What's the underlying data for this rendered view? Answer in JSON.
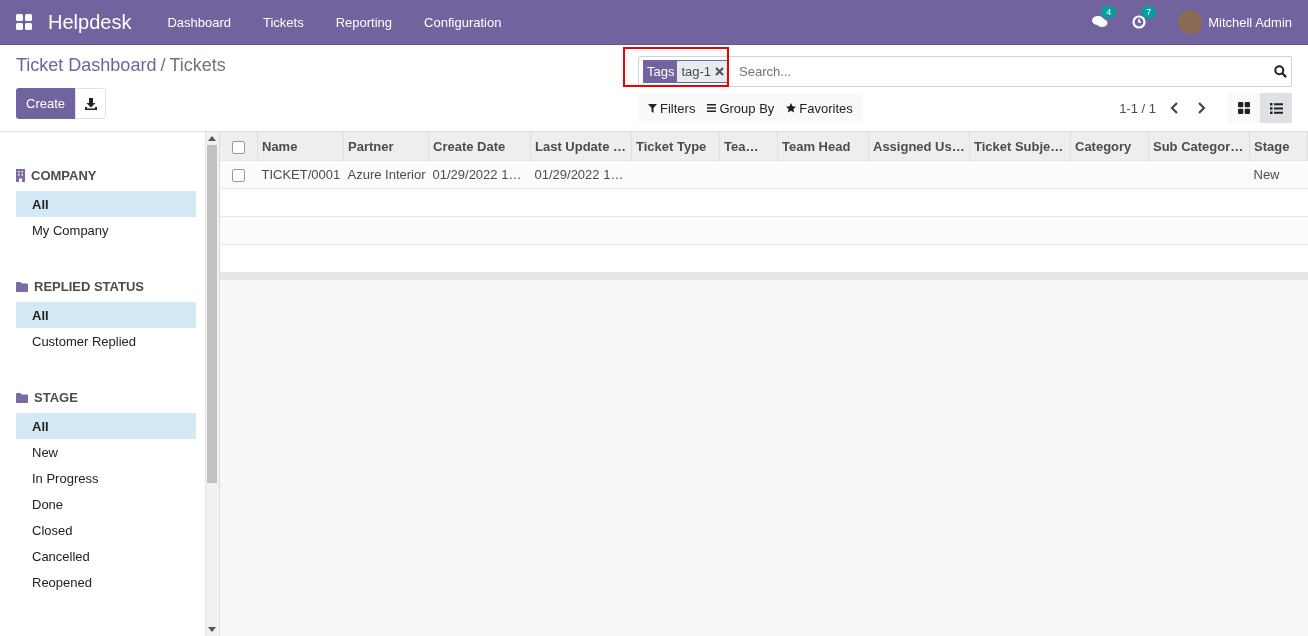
{
  "navbar": {
    "app_name": "Helpdesk",
    "menu": [
      "Dashboard",
      "Tickets",
      "Reporting",
      "Configuration"
    ],
    "messages_count": "4",
    "activities_count": "7",
    "user_name": "Mitchell Admin"
  },
  "breadcrumb": {
    "parent": "Ticket Dashboard",
    "separator": "/",
    "current": "Tickets"
  },
  "buttons": {
    "create": "Create"
  },
  "search": {
    "facets": [
      {
        "label": "Tags",
        "value": "tag-1"
      }
    ],
    "placeholder": "Search...",
    "highlighted": true
  },
  "search_options": [
    "Filters",
    "Group By",
    "Favorites"
  ],
  "pager": "1-1 / 1",
  "views": [
    {
      "kind": "kanban",
      "selected": false
    },
    {
      "kind": "list",
      "selected": true
    }
  ],
  "sidebar": {
    "sections": [
      {
        "kind": "company",
        "title": "COMPANY",
        "items": [
          {
            "label": "All",
            "selected": true
          },
          {
            "label": "My Company",
            "selected": false
          }
        ]
      },
      {
        "kind": "folder",
        "title": "REPLIED STATUS",
        "items": [
          {
            "label": "All",
            "selected": true
          },
          {
            "label": "Customer Replied",
            "selected": false
          }
        ]
      },
      {
        "kind": "folder",
        "title": "STAGE",
        "items": [
          {
            "label": "All",
            "selected": true
          },
          {
            "label": "New",
            "selected": false
          },
          {
            "label": "In Progress",
            "selected": false
          },
          {
            "label": "Done",
            "selected": false
          },
          {
            "label": "Closed",
            "selected": false
          },
          {
            "label": "Cancelled",
            "selected": false
          },
          {
            "label": "Reopened",
            "selected": false
          }
        ]
      }
    ]
  },
  "table": {
    "columns": [
      "Name",
      "Partner",
      "Create Date",
      "Last Update …",
      "Ticket Type",
      "Tea…",
      "Team Head",
      "Assigned Us…",
      "Ticket Subje…",
      "Category",
      "Sub Categor…",
      "Stage"
    ],
    "rows": [
      {
        "checked": false,
        "cells": [
          "TICKET/0001",
          "Azure Interior",
          "01/29/2022 1…",
          "01/29/2022 1…",
          "",
          "",
          "",
          "",
          "",
          "",
          "",
          "New"
        ]
      }
    ],
    "all_checked": false
  }
}
